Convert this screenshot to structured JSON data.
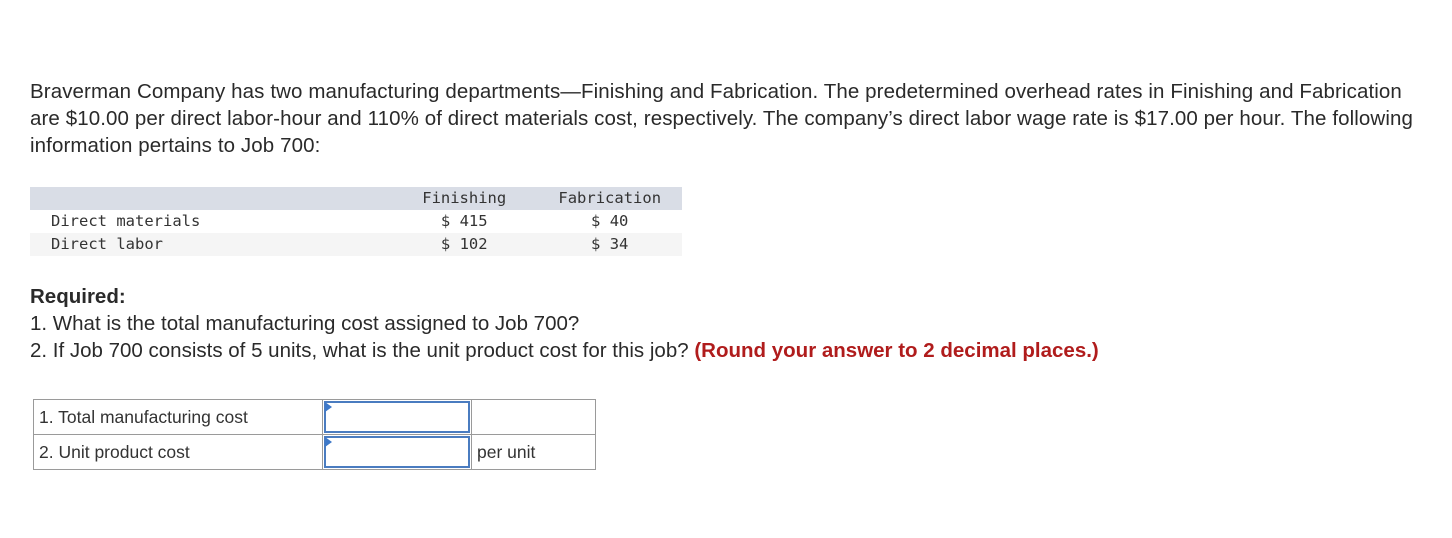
{
  "problem": {
    "intro": "Braverman Company has two manufacturing departments—Finishing and Fabrication. The predetermined overhead rates in Finishing and Fabrication are $10.00 per direct labor-hour and 110% of direct materials cost, respectively. The company’s direct labor wage rate is $17.00 per hour. The following information pertains to Job 700:"
  },
  "cost_table": {
    "headers": [
      "",
      "Finishing",
      "Fabrication"
    ],
    "rows": [
      {
        "label": "Direct materials",
        "finishing": "$ 415",
        "fabrication": "$ 40"
      },
      {
        "label": "Direct labor",
        "finishing": "$ 102",
        "fabrication": "$ 34"
      }
    ]
  },
  "required": {
    "title": "Required:",
    "q1": "1. What is the total manufacturing cost assigned to Job 700?",
    "q2": "2. If Job 700 consists of 5 units, what is the unit product cost for this job?",
    "q2_note": "(Round your answer to 2 decimal places.)"
  },
  "answer_table": {
    "rows": [
      {
        "label": "1. Total manufacturing cost",
        "value": "",
        "unit": ""
      },
      {
        "label": "2. Unit product cost",
        "value": "",
        "unit": "per unit"
      }
    ]
  },
  "colors": {
    "header_bg": "#d9dde6",
    "alt_row_bg": "#f5f5f5",
    "note_red": "#b01c1c",
    "input_border": "#4a7cc0"
  }
}
